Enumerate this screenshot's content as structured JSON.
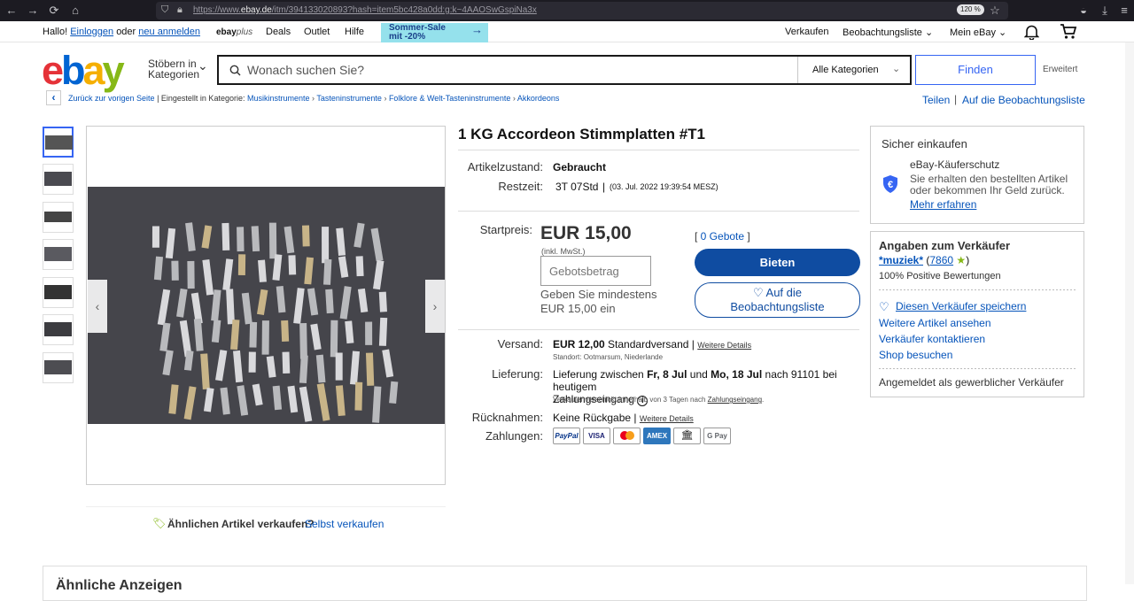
{
  "browser": {
    "url_prefix": "https://www.",
    "url_domain": "ebay.de",
    "url_rest": "/itm/394133020893?hash=item5bc428a0dd:g:k~4AAOSwGspiNa3x",
    "zoom": "120 %"
  },
  "topnav": {
    "greeting": "Hallo!",
    "login": "Einloggen",
    "or": "oder",
    "register": "neu anmelden",
    "ebayplus_a": "ebay",
    "ebayplus_b": "plus",
    "deals": "Deals",
    "outlet": "Outlet",
    "help": "Hilfe",
    "promo_line1": "Sommer-Sale",
    "promo_line2": "mit -20%",
    "sell": "Verkaufen",
    "watchlist": "Beobachtungsliste",
    "myebay": "Mein eBay"
  },
  "header": {
    "browse_line1": "Stöbern in",
    "browse_line2": "Kategorien",
    "search_placeholder": "Wonach suchen Sie?",
    "category_select": "Alle Kategorien",
    "find_button": "Finden",
    "advanced": "Erweitert"
  },
  "breadcrumb": {
    "back": "Zurück zur vorigen Seite",
    "listed_in": "Eingestellt in Kategorie:",
    "items": [
      "Musikinstrumente",
      "Tasteninstrumente",
      "Folklore & Welt-Tasteninstrumente",
      "Akkordeons"
    ],
    "share": "Teilen",
    "add_watch": "Auf die Beobachtungsliste"
  },
  "item": {
    "title": "1 KG Accordeon Stimmplatten #T1",
    "condition_label": "Artikelzustand:",
    "condition": "Gebraucht",
    "remaining_label": "Restzeit:",
    "remaining": "3T 07Std",
    "remaining_date": "(03. Jul. 2022   19:39:54 MESZ)",
    "startprice_label": "Startpreis:",
    "price": "EUR 15,00",
    "vat": "(inkl. MwSt.)",
    "bids": "0 Gebote",
    "bid_placeholder": "Gebotsbetrag",
    "min_bid_line1": "Geben Sie mindestens",
    "min_bid_line2": "EUR 15,00 ein",
    "bid_button": "Bieten",
    "watch_line1": "Auf die",
    "watch_line2": "Beobachtungsliste",
    "shipping_label": "Versand:",
    "shipping_price": "EUR 12,00",
    "shipping_type": "Standardversand",
    "more_details": "Weitere Details",
    "location": "Standort: Ootmarsum, Niederlande",
    "delivery_label": "Lieferung:",
    "delivery_pre": "Lieferung zwischen",
    "delivery_from": "Fr, 8 Jul",
    "delivery_and": "und",
    "delivery_to": "Mo, 18 Jul",
    "delivery_post": "nach 91101 bei heutigem",
    "delivery_line2": "Zahlungseingang",
    "dispatch_note": "Verkäufer verschickt innerhalb von 3 Tagen nach",
    "dispatch_link": "Zahlungseingang",
    "returns_label": "Rücknahmen:",
    "returns": "Keine Rückgabe",
    "payments_label": "Zahlungen:",
    "payment_methods": [
      "PayPal",
      "VISA",
      "MC",
      "AMEX",
      "Bank",
      "G Pay"
    ]
  },
  "sell_similar": {
    "question": "Ähnlichen Artikel verkaufen?",
    "link": "Selbst verkaufen"
  },
  "safe": {
    "title": "Sicher einkaufen",
    "protection_title": "eBay-Käuferschutz",
    "protection_line1": "Sie erhalten den bestellten Artikel",
    "protection_line2": "oder bekommen Ihr Geld zurück.",
    "learn_more": "Mehr erfahren"
  },
  "seller": {
    "title": "Angaben zum Verkäufer",
    "name": "*muziek*",
    "score": "7860",
    "positive": "100% Positive Bewertungen",
    "save": "Diesen Verkäufer speichern",
    "more_items": "Weitere Artikel ansehen",
    "contact": "Verkäufer kontaktieren",
    "shop": "Shop besuchen",
    "type": "Angemeldet als gewerblicher Verkäufer"
  },
  "similar_heading": "Ähnliche Anzeigen",
  "colors": {
    "brand_blue": "#0f4ca1",
    "link": "#0654ba",
    "ebay_red": "#e53238",
    "ebay_blue": "#0064d2",
    "ebay_yellow": "#f5af02",
    "ebay_green": "#86b817"
  }
}
